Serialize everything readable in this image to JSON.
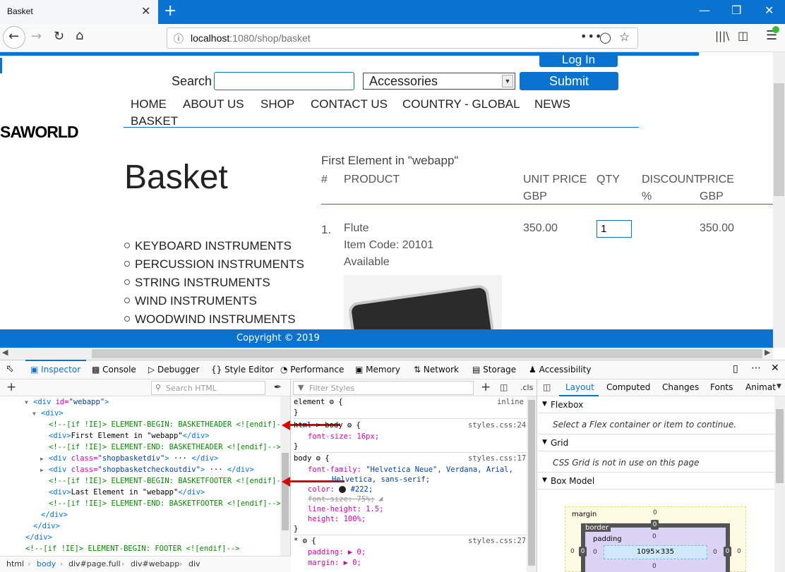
{
  "browser": {
    "tab_title": "Basket",
    "tab_close": "✕",
    "new_tab": "+",
    "url_host": "localhost",
    "url_path": ":1080/shop/basket",
    "url_more": "•••"
  },
  "page": {
    "login": "Log In",
    "search_label": "Search",
    "search_value": "",
    "category_selected": "Accessories",
    "submit": "Submit",
    "nav": [
      "HOME",
      "ABOUT US",
      "SHOP",
      "CONTACT US",
      "COUNTRY - GLOBAL",
      "NEWS"
    ],
    "nav_basket": "BASKET",
    "logo": "SAWORLD",
    "title": "Basket",
    "categories": [
      "KEYBOARD INSTRUMENTS",
      "PERCUSSION INSTRUMENTS",
      "STRING INSTRUMENTS",
      "WIND INSTRUMENTS",
      "WOODWIND INSTRUMENTS"
    ],
    "first_element": "First Element in \"webapp\"",
    "table": {
      "headers": [
        "#",
        "PRODUCT",
        "UNIT PRICE",
        "GBP",
        "QTY",
        "DISCOUNT",
        "%",
        "PRICE",
        "GBP"
      ],
      "row": {
        "num": "1.",
        "product": "Flute",
        "item_code": "Item Code: 20101",
        "availability": "Available",
        "unit_price": "350.00",
        "qty": "1",
        "price": "350.00"
      }
    },
    "footer": "Copyright © 2019"
  },
  "devtools": {
    "tabs": [
      "Inspector",
      "Console",
      "Debugger",
      "Style Editor",
      "Performance",
      "Memory",
      "Network",
      "Storage",
      "Accessibility"
    ],
    "search_html_placeholder": "Search HTML",
    "filter_styles_placeholder": "Filter Styles",
    "cls": ".cls",
    "layout_tabs": [
      "Layout",
      "Computed",
      "Changes",
      "Fonts",
      "Animat"
    ],
    "markup": [
      {
        "indent": 0,
        "arrow": "▼",
        "parts": [
          [
            "tag",
            "<div "
          ],
          [
            "attr",
            "id="
          ],
          [
            "aval",
            "\"webapp\""
          ],
          [
            "tag",
            ">"
          ]
        ]
      },
      {
        "indent": 1,
        "arrow": "▼",
        "parts": [
          [
            "tag",
            "<div>"
          ]
        ]
      },
      {
        "indent": 2,
        "arrow": "",
        "parts": [
          [
            "cmt",
            "<!--[if !IE]> ELEMENT-BEGIN: BASKETHEADER <![endif]-->"
          ]
        ]
      },
      {
        "indent": 2,
        "arrow": "",
        "parts": [
          [
            "tag",
            "<div>"
          ],
          [
            "txt",
            "First Element in \"webapp\""
          ],
          [
            "tag",
            "</div>"
          ]
        ]
      },
      {
        "indent": 2,
        "arrow": "",
        "parts": [
          [
            "cmt",
            "<!--[if !IE]> ELEMENT-END: BASKETHEADER <![endif]-->"
          ]
        ]
      },
      {
        "indent": 2,
        "arrow": "▶",
        "parts": [
          [
            "tag",
            "<div "
          ],
          [
            "attr",
            "class="
          ],
          [
            "aval",
            "\"shopbasketdiv\""
          ],
          [
            "tag",
            ">"
          ],
          [
            "txt",
            " ··· "
          ],
          [
            "tag",
            "</div>"
          ]
        ]
      },
      {
        "indent": 2,
        "arrow": "▶",
        "parts": [
          [
            "tag",
            "<div "
          ],
          [
            "attr",
            "class="
          ],
          [
            "aval",
            "\"shopbasketcheckoutdiv\""
          ],
          [
            "tag",
            ">"
          ],
          [
            "txt",
            " ··· "
          ],
          [
            "tag",
            "</div>"
          ]
        ]
      },
      {
        "indent": 2,
        "arrow": "",
        "parts": [
          [
            "cmt",
            "<!--[if !IE]> ELEMENT-BEGIN: BASKETFOOTER <![endif]-->"
          ]
        ]
      },
      {
        "indent": 2,
        "arrow": "",
        "parts": [
          [
            "tag",
            "<div>"
          ],
          [
            "txt",
            "Last Element in \"webapp\""
          ],
          [
            "tag",
            "</div>"
          ]
        ]
      },
      {
        "indent": 2,
        "arrow": "",
        "parts": [
          [
            "cmt",
            "<!--[if !IE]> ELEMENT-END: BASKETFOOTER <![endif]-->"
          ]
        ]
      },
      {
        "indent": 1,
        "arrow": "",
        "parts": [
          [
            "tag",
            "</div>"
          ]
        ]
      },
      {
        "indent": 0,
        "arrow": "",
        "parts": [
          [
            "tag",
            "</div>"
          ]
        ]
      },
      {
        "indent": -1,
        "arrow": "",
        "parts": [
          [
            "tag",
            "</div>"
          ]
        ]
      },
      {
        "indent": -1,
        "arrow": "",
        "parts": [
          [
            "cmt",
            "<!--[if !IE]> ELEMENT-BEGIN: FOOTER <![endif]-->"
          ]
        ]
      }
    ],
    "breadcrumbs": [
      "html",
      "body",
      "div#page.full",
      "div#webapp",
      "div"
    ],
    "styles": {
      "element_rule": "element ⚙ {",
      "element_src": "inline",
      "rule_html_body_src": "styles.css:24",
      "font_size_16": "font-size: 16px;",
      "body_rule": "body ⚙ {",
      "body_src": "styles.css:17",
      "font_family_prop": "font-family:",
      "font_family_val": "\"Helvetica Neue\", Verdana, Arial,",
      "font_family_val2": "Helvetica, sans-serif;",
      "color_prop": "color:",
      "color_val": "#222;",
      "font_size_75": "font-size: 75%;",
      "line_height": "line-height: 1.5;",
      "height": "height: 100%;",
      "star_rule": "* ⚙ {",
      "star_src": "styles.css:27",
      "padding": "padding: ▶ 0;",
      "margin": "margin: ▶ 0;",
      "close": "}"
    },
    "layout": {
      "flexbox_title": "Flexbox",
      "flexbox_msg": "Select a Flex container or item to continue.",
      "grid_title": "Grid",
      "grid_msg": "CSS Grid is not in use on this page",
      "boxmodel_title": "Box Model",
      "bm_margin": "margin",
      "bm_border": "border",
      "bm_padding": "padding",
      "bm_content": "1095×335",
      "zero": "0"
    }
  },
  "colors": {
    "accent": "#0a73d0",
    "arrow": "#e00000"
  }
}
